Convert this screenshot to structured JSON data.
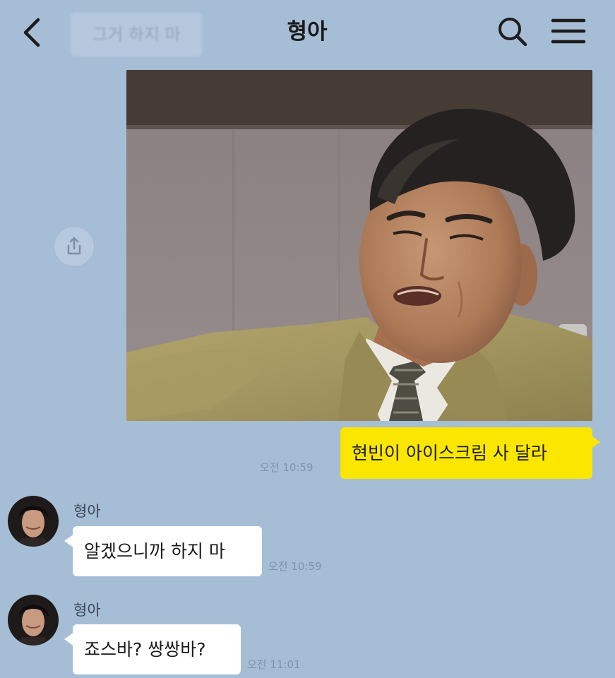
{
  "header": {
    "title": "형아",
    "search_chip": "그거 하지 마",
    "back_icon": "chevron-left-icon",
    "search_icon": "search-icon",
    "menu_icon": "hamburger-menu-icon"
  },
  "messages": [
    {
      "type": "image",
      "from": "me",
      "description_icon": "photo-icon",
      "share_icon": "share-icon"
    },
    {
      "type": "text",
      "from": "me",
      "text": "현빈이 아이스크림 사 달라",
      "time": "오전 10:59"
    },
    {
      "type": "text",
      "from": "other",
      "sender": "형아",
      "text": "알겠으니까 하지 마",
      "time": "오전 10:59"
    },
    {
      "type": "text",
      "from": "other",
      "sender": "형아",
      "text": "죠스바? 쌍쌍바?",
      "time": "오전 11:01"
    }
  ],
  "colors": {
    "background": "#a6bdd6",
    "my_bubble": "#fbe600",
    "other_bubble": "#ffffff"
  }
}
